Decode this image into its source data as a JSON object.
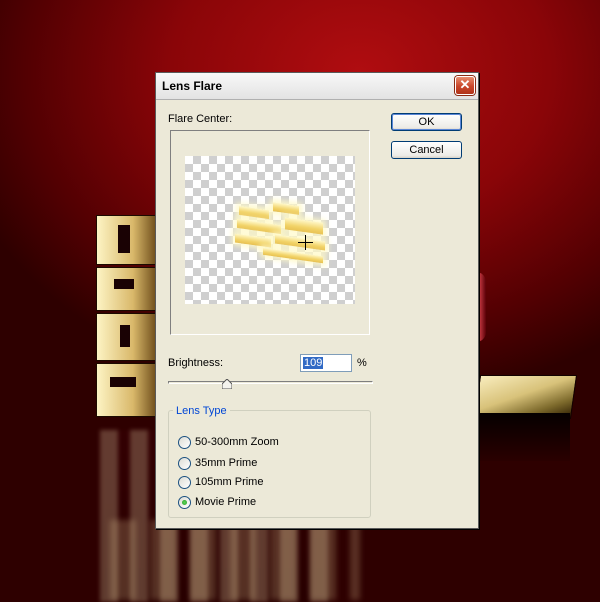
{
  "dialog": {
    "title": "Lens Flare",
    "close_symbol": "✕",
    "flare_center_label": "Flare Center:",
    "brightness_label": "Brightness:",
    "brightness_value": "109",
    "brightness_unit": "%",
    "brightness_slider_percent": 29,
    "ok_label": "OK",
    "cancel_label": "Cancel",
    "lens_type": {
      "legend": "Lens Type",
      "options": [
        {
          "label": "50-300mm Zoom",
          "checked": false
        },
        {
          "label": "35mm Prime",
          "checked": false
        },
        {
          "label": "105mm Prime",
          "checked": false
        },
        {
          "label": "Movie Prime",
          "checked": true
        }
      ]
    }
  },
  "colors": {
    "background_red": "#8a0508",
    "radio_checked_dot": "#21a121",
    "group_legend_blue": "#0046d5",
    "close_button_red": "#c9462a"
  },
  "icons": {
    "close": "close-icon",
    "crosshair": "crosshair-icon",
    "slider_thumb": "slider-thumb-icon"
  }
}
